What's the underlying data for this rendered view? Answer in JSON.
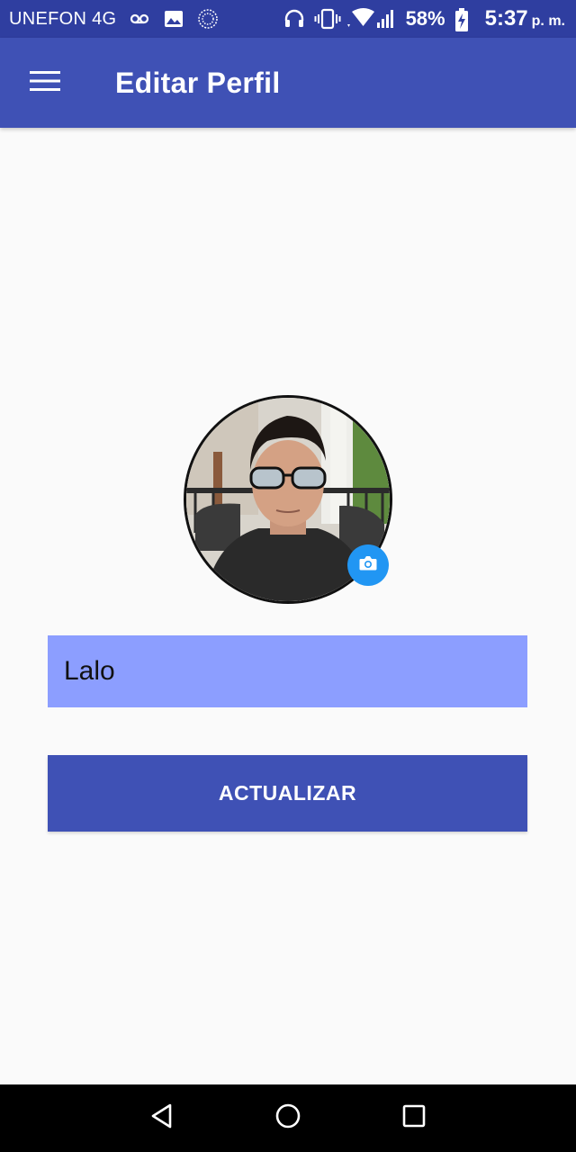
{
  "status_bar": {
    "carrier": "UNEFON 4G",
    "battery_percent": "58%",
    "time": "5:37",
    "time_suffix": "p. m.",
    "icons": [
      "voicemail-icon",
      "gallery-icon",
      "sync-icon",
      "headphones-icon",
      "vibrate-icon",
      "wifi-icon",
      "signal-icon",
      "battery-charging-icon"
    ]
  },
  "app_bar": {
    "title": "Editar Perfil",
    "menu_icon": "hamburger-menu-icon"
  },
  "profile": {
    "camera_icon": "camera-icon"
  },
  "form": {
    "name_value": "Lalo",
    "update_label": "ACTUALIZAR"
  },
  "colors": {
    "primary": "#3f51b5",
    "primary_dark": "#2f3ea0",
    "input_bg": "#8c9eff",
    "camera_badge": "#2196f3",
    "background": "#fafafa"
  },
  "nav_bar": {
    "icons": [
      "back-icon",
      "home-icon",
      "recents-icon"
    ]
  }
}
